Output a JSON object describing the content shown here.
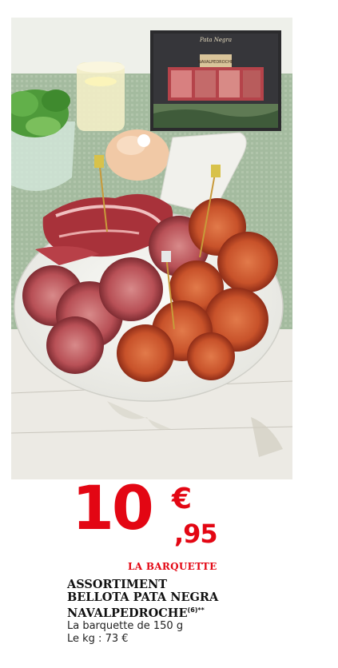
{
  "box_brand": "Pata Negra",
  "box_logo": "NAVALPEDROCHE",
  "price": {
    "euros": "10",
    "currency": "€",
    "cents": ",95"
  },
  "unit_label": "LA BARQUETTE",
  "product": {
    "title_lines": [
      "ASSORTIMENT",
      "BELLOTA PATA NEGRA",
      "NAVALPEDROCHE"
    ],
    "title_suffix": "(6)**",
    "details": [
      "La barquette de 150 g",
      "Le kg : 73 €"
    ]
  },
  "colors": {
    "price_red": "#e30613",
    "text_dark": "#111111"
  }
}
